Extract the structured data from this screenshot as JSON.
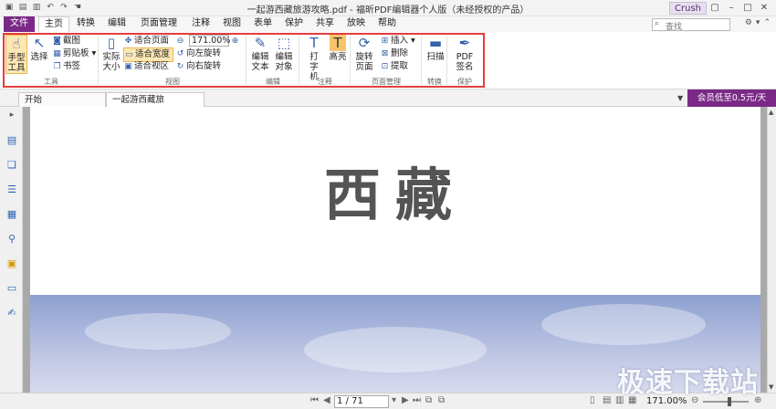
{
  "window": {
    "title": "一起游西藏旅游攻略.pdf - 福昕PDF编辑器个人版（未经授权的产品）",
    "user": "Crush"
  },
  "quick_access": [
    "folder-icon",
    "save-icon",
    "print-icon",
    "undo-icon",
    "redo-icon",
    "hand-icon"
  ],
  "ribbon_tabs": [
    {
      "label": "文件"
    },
    {
      "label": "主页"
    },
    {
      "label": "转换"
    },
    {
      "label": "编辑"
    },
    {
      "label": "页面管理"
    },
    {
      "label": "注释"
    },
    {
      "label": "视图"
    },
    {
      "label": "表单"
    },
    {
      "label": "保护"
    },
    {
      "label": "共享"
    },
    {
      "label": "放映"
    },
    {
      "label": "帮助"
    }
  ],
  "search": {
    "placeholder": "查找"
  },
  "ribbon": {
    "tools": {
      "name": "工具",
      "hand": "手型工具",
      "select": "选择",
      "snapshot": "截图",
      "clipboard": "剪贴板",
      "bookmark": "书签"
    },
    "view": {
      "name": "视图",
      "actual_size": "实际大小",
      "fit_page": "适合页面",
      "fit_width": "适合宽度",
      "fit_visible": "适合视区",
      "zoom": "171.00%",
      "rotate_left": "向左旋转",
      "rotate_right": "向右旋转"
    },
    "edit": {
      "name": "编辑",
      "edit_text": "编辑文本",
      "edit_object": "编辑对象"
    },
    "comment": {
      "name": "注释",
      "typewriter": "打字机",
      "highlight": "高亮"
    },
    "pages": {
      "name": "页面管理",
      "rotate_page": "旋转页面",
      "insert": "插入",
      "delete": "删除",
      "extract": "提取"
    },
    "convert": {
      "name": "转换",
      "scan": "扫描"
    },
    "protect": {
      "name": "保护",
      "sign": "PDF签名"
    }
  },
  "doc_tabs": [
    {
      "label": "开始"
    },
    {
      "label": "一起游西藏旅游..."
    }
  ],
  "promo": "会员低至0.5元/天",
  "page": {
    "heading": "西藏"
  },
  "status": {
    "page": "1 / 71",
    "zoom": "171.00%"
  },
  "watermark": "极速下载站",
  "colors": {
    "accent": "#7a2a86",
    "highlight_border": "#e33d3d",
    "icon_blue": "#3561a8"
  }
}
